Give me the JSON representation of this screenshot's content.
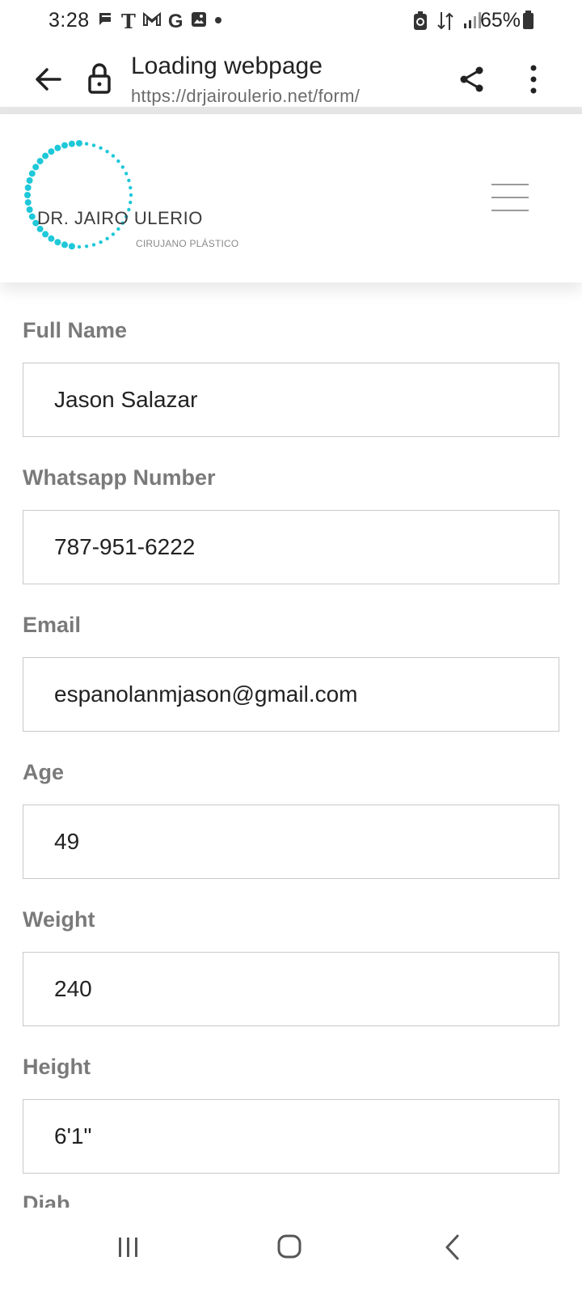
{
  "status_bar": {
    "time": "3:28",
    "battery": "65%",
    "icons_left": [
      "chat-icon",
      "tmobile-icon",
      "gmail-icon",
      "google-icon",
      "gallery-icon",
      "dot-icon"
    ],
    "icons_right": [
      "battery-saver-icon",
      "data-transfer-icon",
      "signal-icon",
      "battery-icon"
    ]
  },
  "browser": {
    "title": "Loading webpage",
    "url": "https://drjairoulerio.net/form/"
  },
  "site": {
    "logo_main": "DR. JAIRO ULERIO",
    "logo_sub": "CIRUJANO PLÁSTICO",
    "accent_color": "#1ec8d8"
  },
  "form": {
    "fields": [
      {
        "label": "Full Name",
        "value": "Jason Salazar"
      },
      {
        "label": "Whatsapp Number",
        "value": "787-951-6222"
      },
      {
        "label": "Email",
        "value": "espanolanmjason@gmail.com"
      },
      {
        "label": "Age",
        "value": "49"
      },
      {
        "label": "Weight",
        "value": "240"
      },
      {
        "label": "Height",
        "value": "6'1\""
      }
    ],
    "partial_label": "Diab"
  }
}
